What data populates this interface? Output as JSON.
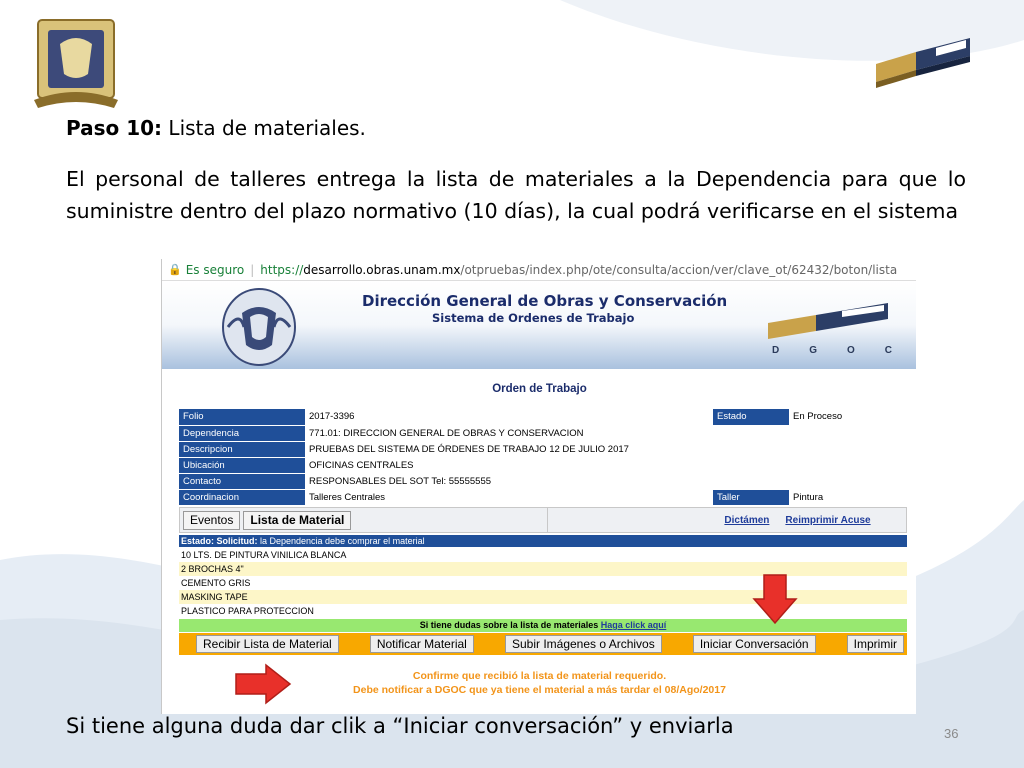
{
  "slide": {
    "heading_bold": "Paso 10:",
    "heading_rest": " Lista de materiales.",
    "paragraph": "El personal de talleres entrega la lista de materiales a la Dependencia para que lo suministre dentro del plazo normativo (10 días), la cual podrá verificarse en el sistema",
    "footer": "Si tiene alguna duda dar clik a “Iniciar conversación” y enviarla",
    "page_number": "36"
  },
  "browser": {
    "secure_label": "Es seguro",
    "url_scheme": "https://",
    "url_host": "desarrollo.obras.unam.mx",
    "url_path": "/otpruebas/index.php/ote/consulta/accion/ver/clave_ot/62432/boton/lista"
  },
  "banner": {
    "title": "Dirección General de Obras y Conservación",
    "subtitle": "Sistema de Ordenes de Trabajo",
    "logo_text": "DGOC"
  },
  "order": {
    "title": "Orden de Trabajo",
    "fields": {
      "folio_label": "Folio",
      "folio": "2017-3396",
      "estado_label": "Estado",
      "estado": "En Proceso",
      "dependencia_label": "Dependencia",
      "dependencia": "771.01: DIRECCION GENERAL DE OBRAS Y CONSERVACION",
      "descripcion_label": "Descripcion",
      "descripcion": "PRUEBAS DEL SISTEMA DE ÓRDENES DE TRABAJO 12 DE JULIO 2017",
      "ubicacion_label": "Ubicación",
      "ubicacion": "OFICINAS CENTRALES",
      "contacto_label": "Contacto",
      "contacto": "RESPONSABLES DEL SOT Tel: 55555555",
      "coordinacion_label": "Coordinacion",
      "coordinacion": "Talleres Centrales",
      "taller_label": "Taller",
      "taller": "Pintura"
    }
  },
  "toolbar": {
    "eventos": "Eventos",
    "lista_material": "Lista de Material",
    "dictamen": "Dictámen",
    "reimprimir": "Reimprimir Acuse"
  },
  "estado_bar": {
    "label": "Estado: Solicitud:",
    "text": " la Dependencia debe comprar el material"
  },
  "materials": [
    "10 LTS. DE PINTURA VINILICA BLANCA",
    "2 BROCHAS 4\"",
    "CEMENTO GRIS",
    "MASKING TAPE",
    "PLASTICO PARA PROTECCION"
  ],
  "dudas": {
    "text": "Si tiene dudas sobre la lista de materiales ",
    "link": "Haga click aquí"
  },
  "actions": {
    "recibir": "Recibir Lista de Material",
    "notificar": "Notificar Material",
    "subir": "Subir Imágenes o Archivos",
    "iniciar": "Iniciar Conversación",
    "imprimir": "Imprimir"
  },
  "confirm": {
    "line1": "Confirme que recibió la lista de material requerido.",
    "line2": "Debe notificar a DGOC que ya tiene el material a más tardar el 08/Ago/2017"
  },
  "colors": {
    "label_blue": "#1f4f99",
    "action_orange": "#f8a800",
    "dudas_green": "#98e870",
    "arrow_red": "#e8302a",
    "confirm_text": "#f2941a"
  }
}
